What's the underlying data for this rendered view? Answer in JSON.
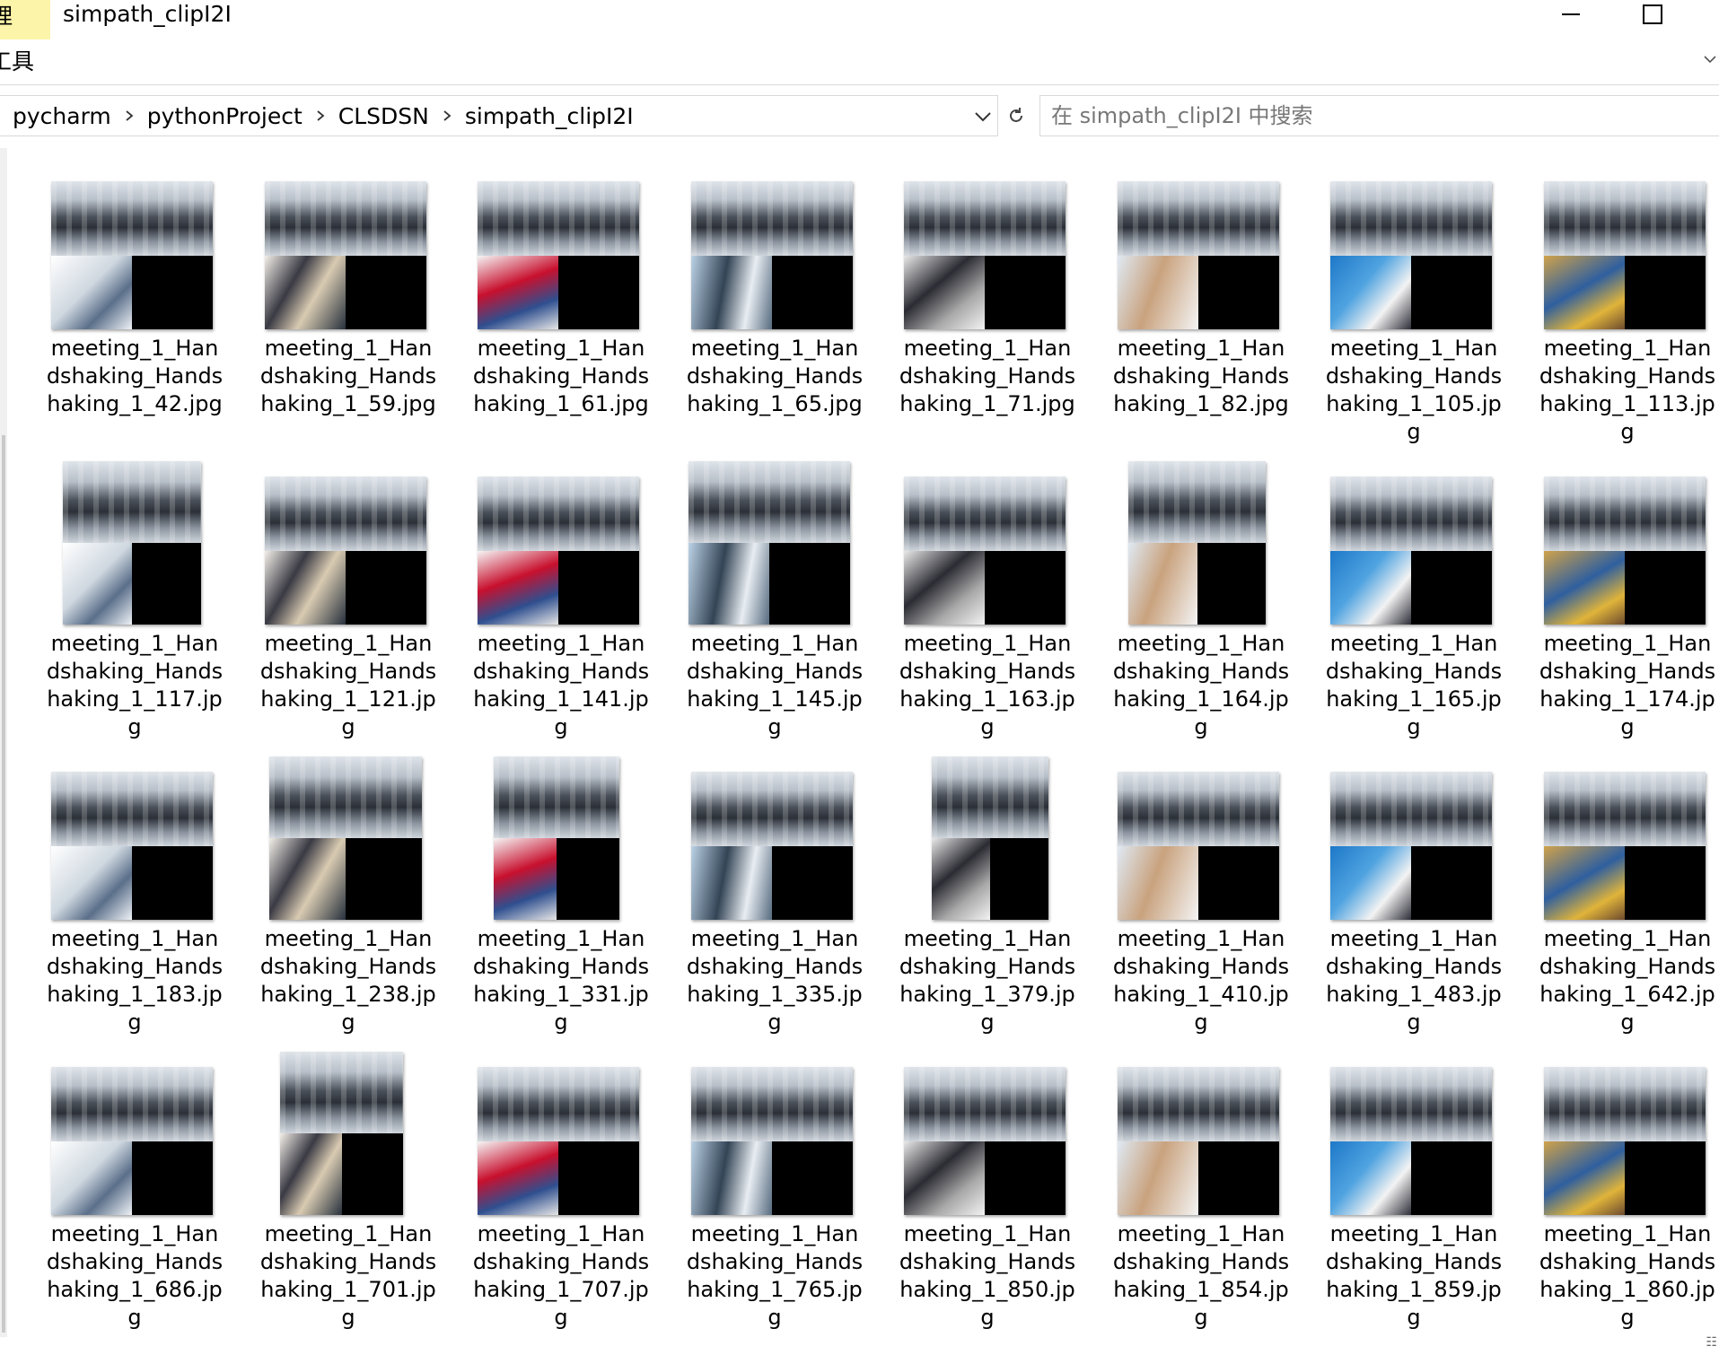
{
  "titlebar": {
    "tab_label": "理",
    "title": "simpath_clipI2I"
  },
  "ribbon": {
    "tab_label": "工具"
  },
  "address": {
    "crumbs": [
      "pycharm",
      "pythonProject",
      "CLSDSN",
      "simpath_clipI2I"
    ]
  },
  "search": {
    "placeholder": "在 simpath_clipI2I 中搜索"
  },
  "icons": {
    "minimize": "minimize-icon",
    "maximize": "maximize-icon",
    "refresh": "refresh-icon",
    "dropdown": "chevron-down-icon",
    "expand_ribbon": "chevron-down-icon",
    "view_toggle": "details-view-icon"
  },
  "files": [
    "meeting_1_Handshaking_Handshaking_1_42.jpg",
    "meeting_1_Handshaking_Handshaking_1_59.jpg",
    "meeting_1_Handshaking_Handshaking_1_61.jpg",
    "meeting_1_Handshaking_Handshaking_1_65.jpg",
    "meeting_1_Handshaking_Handshaking_1_71.jpg",
    "meeting_1_Handshaking_Handshaking_1_82.jpg",
    "meeting_1_Handshaking_Handshaking_1_105.jpg",
    "meeting_1_Handshaking_Handshaking_1_113.jpg",
    "meeting_1_Handshaking_Handshaking_1_117.jpg",
    "meeting_1_Handshaking_Handshaking_1_121.jpg",
    "meeting_1_Handshaking_Handshaking_1_141.jpg",
    "meeting_1_Handshaking_Handshaking_1_145.jpg",
    "meeting_1_Handshaking_Handshaking_1_163.jpg",
    "meeting_1_Handshaking_Handshaking_1_164.jpg",
    "meeting_1_Handshaking_Handshaking_1_165.jpg",
    "meeting_1_Handshaking_Handshaking_1_174.jpg",
    "meeting_1_Handshaking_Handshaking_1_183.jpg",
    "meeting_1_Handshaking_Handshaking_1_238.jpg",
    "meeting_1_Handshaking_Handshaking_1_331.jpg",
    "meeting_1_Handshaking_Handshaking_1_335.jpg",
    "meeting_1_Handshaking_Handshaking_1_379.jpg",
    "meeting_1_Handshaking_Handshaking_1_410.jpg",
    "meeting_1_Handshaking_Handshaking_1_483.jpg",
    "meeting_1_Handshaking_Handshaking_1_642.jpg",
    "meeting_1_Handshaking_Handshaking_1_686.jpg",
    "meeting_1_Handshaking_Handshaking_1_701.jpg",
    "meeting_1_Handshaking_Handshaking_1_707.jpg",
    "meeting_1_Handshaking_Handshaking_1_765.jpg",
    "meeting_1_Handshaking_Handshaking_1_850.jpg",
    "meeting_1_Handshaking_Handshaking_1_854.jpg",
    "meeting_1_Handshaking_Handshaking_1_859.jpg",
    "meeting_1_Handshaking_Handshaking_1_860.jpg"
  ]
}
